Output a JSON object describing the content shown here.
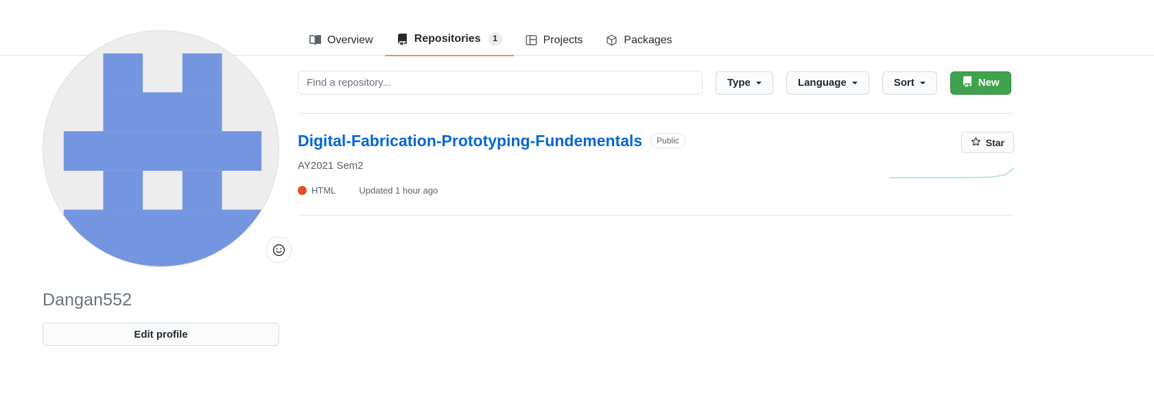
{
  "profile": {
    "avatar_name": "identicon-avatar",
    "avatar_bg_color": "#ededed",
    "avatar_fg_color": "#7495e0",
    "emoji_status_icon": "smiley-icon",
    "username": "Dangan552",
    "edit_profile_label": "Edit profile"
  },
  "nav": {
    "tabs": [
      {
        "label": "Overview",
        "icon": "book-icon",
        "selected": false,
        "count": null
      },
      {
        "label": "Repositories",
        "icon": "repo-icon",
        "selected": true,
        "count": "1"
      },
      {
        "label": "Projects",
        "icon": "project-icon",
        "selected": false,
        "count": null
      },
      {
        "label": "Packages",
        "icon": "package-icon",
        "selected": false,
        "count": null
      }
    ],
    "selected_underline_color": "#f9826c"
  },
  "filters": {
    "search_placeholder": "Find a repository...",
    "search_value": "",
    "type_label": "Type",
    "language_label": "Language",
    "sort_label": "Sort",
    "new_label": "New",
    "new_icon": "repo-icon",
    "new_button_color": "#3fa34d"
  },
  "repositories": [
    {
      "name": "Digital-Fabrication-Prototyping-Fundementals",
      "visibility": "Public",
      "description": "AY2021 Sem2",
      "language": "HTML",
      "language_color": "#e34c26",
      "updated": "Updated 1 hour ago",
      "star_label": "Star",
      "star_icon": "star-icon",
      "sparkline_color": "#a6e3b8"
    }
  ]
}
